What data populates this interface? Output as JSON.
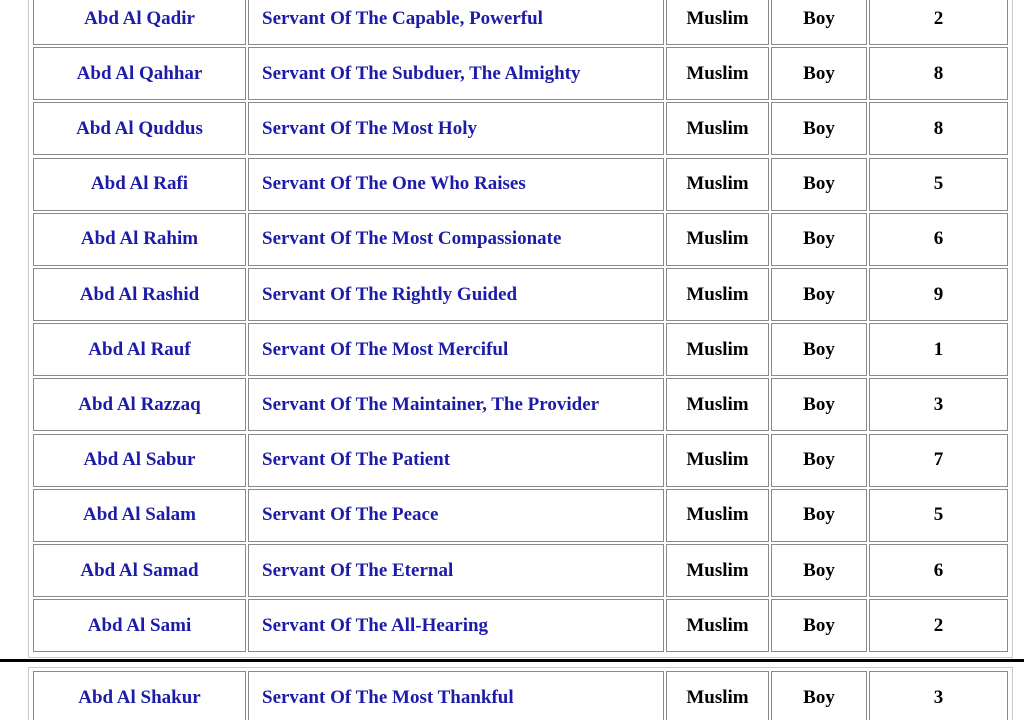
{
  "table_top": {
    "rows": [
      {
        "name": "Abd Al Qadir",
        "meaning": "Servant Of The Capable, Powerful",
        "religion": "Muslim",
        "gender": "Boy",
        "number": "2"
      },
      {
        "name": "Abd Al Qahhar",
        "meaning": "Servant Of The Subduer, The Almighty",
        "religion": "Muslim",
        "gender": "Boy",
        "number": "8"
      },
      {
        "name": "Abd Al Quddus",
        "meaning": "Servant Of The Most Holy",
        "religion": "Muslim",
        "gender": "Boy",
        "number": "8"
      },
      {
        "name": "Abd Al Rafi",
        "meaning": "Servant Of The One Who Raises",
        "religion": "Muslim",
        "gender": "Boy",
        "number": "5"
      },
      {
        "name": "Abd Al Rahim",
        "meaning": "Servant Of The Most Compassionate",
        "religion": "Muslim",
        "gender": "Boy",
        "number": "6"
      },
      {
        "name": "Abd Al Rashid",
        "meaning": "Servant Of The Rightly Guided",
        "religion": "Muslim",
        "gender": "Boy",
        "number": "9"
      },
      {
        "name": "Abd Al Rauf",
        "meaning": "Servant Of The Most Merciful",
        "religion": "Muslim",
        "gender": "Boy",
        "number": "1"
      },
      {
        "name": "Abd Al Razzaq",
        "meaning": "Servant Of The Maintainer, The Provider",
        "religion": "Muslim",
        "gender": "Boy",
        "number": "3"
      },
      {
        "name": "Abd Al Sabur",
        "meaning": "Servant Of The Patient",
        "religion": "Muslim",
        "gender": "Boy",
        "number": "7"
      },
      {
        "name": "Abd Al Salam",
        "meaning": "Servant Of The Peace",
        "religion": "Muslim",
        "gender": "Boy",
        "number": "5"
      },
      {
        "name": "Abd Al Samad",
        "meaning": "Servant Of The Eternal",
        "religion": "Muslim",
        "gender": "Boy",
        "number": "6"
      },
      {
        "name": "Abd Al Sami",
        "meaning": "Servant Of The All-Hearing",
        "religion": "Muslim",
        "gender": "Boy",
        "number": "2"
      }
    ]
  },
  "table_bottom": {
    "rows": [
      {
        "name": "Abd Al Shakur",
        "meaning": "Servant Of The Most Thankful",
        "religion": "Muslim",
        "gender": "Boy",
        "number": "3"
      }
    ]
  },
  "colors": {
    "name_text": "#1c1ca8",
    "other_text": "#000000",
    "cell_border": "#8a8a8a"
  }
}
